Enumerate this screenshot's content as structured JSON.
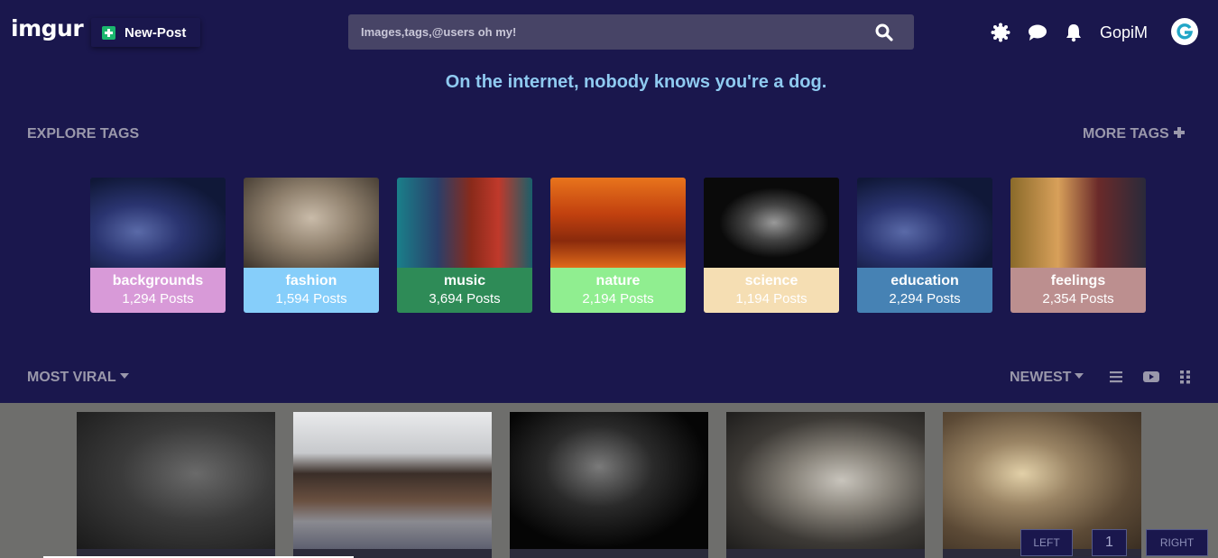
{
  "header": {
    "logo": "imgur",
    "new_post_label": "New-Post",
    "search_placeholder": "Images,tags,@users oh my!",
    "username": "GopiM",
    "icons": [
      "sun-settings-icon",
      "chat-icon",
      "bell-icon",
      "search-icon",
      "avatar-g-icon"
    ]
  },
  "tagline": "On the internet, nobody knows you're a dog.",
  "explore": {
    "title": "EXPLORE TAGS",
    "more_label": "MORE TAGS",
    "tags": [
      {
        "name": "backgrounds",
        "count": "1,294 Posts",
        "color": "#d89ad8"
      },
      {
        "name": "fashion",
        "count": "1,594 Posts",
        "color": "#86cefa"
      },
      {
        "name": "music",
        "count": "3,694 Posts",
        "color": "#2e8b57"
      },
      {
        "name": "nature",
        "count": "2,194 Posts",
        "color": "#90ee90"
      },
      {
        "name": "science",
        "count": "1,194 Posts",
        "color": "#f5deb3"
      },
      {
        "name": "education",
        "count": "2,294 Posts",
        "color": "#4682b4"
      },
      {
        "name": "feelings",
        "count": "2,354 Posts",
        "color": "#bc8f8f"
      }
    ]
  },
  "sort": {
    "left_label": "MOST VIRAL",
    "right_label": "NEWEST",
    "view_icons": [
      "list-view-icon",
      "video-view-icon",
      "grid-view-icon"
    ]
  },
  "pagination": {
    "left_label": "LEFT",
    "page": "1",
    "right_label": "RIGHT"
  }
}
